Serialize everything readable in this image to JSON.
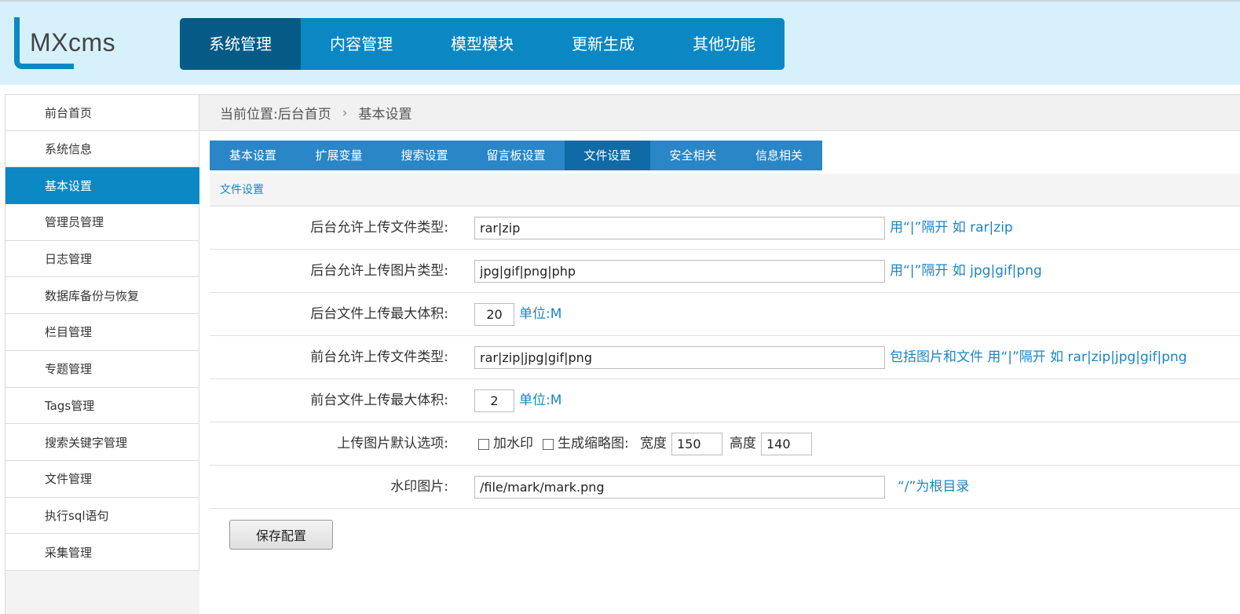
{
  "logo": {
    "text": "MXcms"
  },
  "topnav": [
    {
      "label": "系统管理",
      "active": true
    },
    {
      "label": "内容管理"
    },
    {
      "label": "模型模块"
    },
    {
      "label": "更新生成"
    },
    {
      "label": "其他功能"
    }
  ],
  "sidebar": [
    {
      "label": "前台首页"
    },
    {
      "label": "系统信息"
    },
    {
      "label": "基本设置",
      "active": true
    },
    {
      "label": "管理员管理"
    },
    {
      "label": "日志管理"
    },
    {
      "label": "数据库备份与恢复"
    },
    {
      "label": "栏目管理"
    },
    {
      "label": "专题管理"
    },
    {
      "label": "Tags管理"
    },
    {
      "label": "搜索关键字管理"
    },
    {
      "label": "文件管理"
    },
    {
      "label": "执行sql语句"
    },
    {
      "label": "采集管理"
    }
  ],
  "breadcrumb": {
    "prefix": "当前位置:",
    "home": "后台首页",
    "sep": "›",
    "current": "基本设置"
  },
  "tabs": [
    {
      "label": "基本设置"
    },
    {
      "label": "扩展变量"
    },
    {
      "label": "搜索设置"
    },
    {
      "label": "留言板设置"
    },
    {
      "label": "文件设置",
      "active": true
    },
    {
      "label": "安全相关"
    },
    {
      "label": "信息相关"
    }
  ],
  "section_title": "文件设置",
  "form": {
    "admin_file_types": {
      "label": "后台允许上传文件类型:",
      "value": "rar|zip",
      "hint": "用“|”隔开 如 rar|zip"
    },
    "admin_image_types": {
      "label": "后台允许上传图片类型:",
      "value": "jpg|gif|png|php",
      "hint": "用“|”隔开 如 jpg|gif|png"
    },
    "admin_max_size": {
      "label": "后台文件上传最大体积:",
      "value": "20",
      "hint": "单位:M"
    },
    "front_file_types": {
      "label": "前台允许上传文件类型:",
      "value": "rar|zip|jpg|gif|png",
      "hint": "包括图片和文件 用“|”隔开 如 rar|zip|jpg|gif|png"
    },
    "front_max_size": {
      "label": "前台文件上传最大体积:",
      "value": "2",
      "hint": "单位:M"
    },
    "image_defaults": {
      "label": "上传图片默认选项:",
      "watermark": "加水印",
      "thumbnail": "生成缩略图:",
      "width_label": "宽度",
      "width": "150",
      "height_label": "高度",
      "height": "140"
    },
    "watermark_image": {
      "label": "水印图片:",
      "value": "/file/mark/mark.png",
      "hint": "“/”为根目录"
    }
  },
  "save_label": "保存配置"
}
